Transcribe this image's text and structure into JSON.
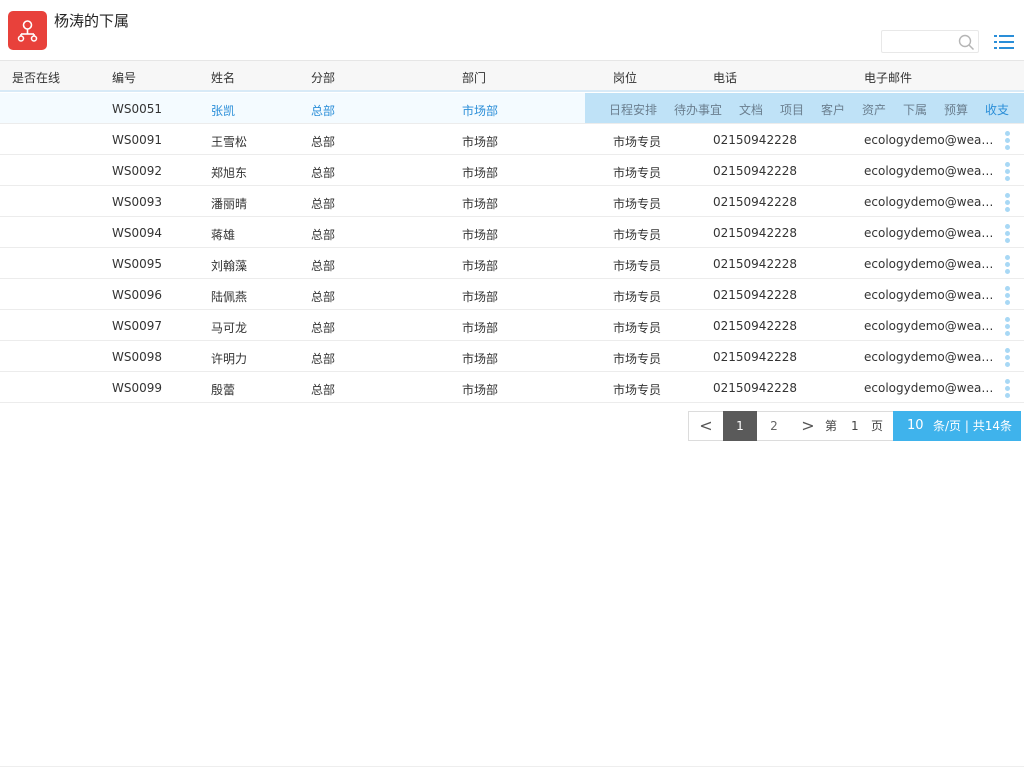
{
  "header": {
    "title": "杨涛的下属",
    "logo_icon": "org-tree-icon",
    "search": {
      "value": "",
      "placeholder": ""
    },
    "menu_icon": "list-menu-icon"
  },
  "table": {
    "columns": [
      "是否在线",
      "编号",
      "姓名",
      "分部",
      "部门",
      "岗位",
      "电话",
      "电子邮件"
    ],
    "rows": [
      {
        "online": "",
        "id": "WS0051",
        "name": "张凯",
        "branch": "总部",
        "dept": "市场部",
        "post": "",
        "phone": "",
        "email": ""
      },
      {
        "online": "",
        "id": "WS0091",
        "name": "王雪松",
        "branch": "总部",
        "dept": "市场部",
        "post": "市场专员",
        "phone": "02150942228",
        "email": "ecologydemo@weav..."
      },
      {
        "online": "",
        "id": "WS0092",
        "name": "郑旭东",
        "branch": "总部",
        "dept": "市场部",
        "post": "市场专员",
        "phone": "02150942228",
        "email": "ecologydemo@weav..."
      },
      {
        "online": "",
        "id": "WS0093",
        "name": "潘丽晴",
        "branch": "总部",
        "dept": "市场部",
        "post": "市场专员",
        "phone": "02150942228",
        "email": "ecologydemo@weav..."
      },
      {
        "online": "",
        "id": "WS0094",
        "name": "蒋雄",
        "branch": "总部",
        "dept": "市场部",
        "post": "市场专员",
        "phone": "02150942228",
        "email": "ecologydemo@weav..."
      },
      {
        "online": "",
        "id": "WS0095",
        "name": "刘翰藻",
        "branch": "总部",
        "dept": "市场部",
        "post": "市场专员",
        "phone": "02150942228",
        "email": "ecologydemo@weav..."
      },
      {
        "online": "",
        "id": "WS0096",
        "name": "陆佩燕",
        "branch": "总部",
        "dept": "市场部",
        "post": "市场专员",
        "phone": "02150942228",
        "email": "ecologydemo@weav..."
      },
      {
        "online": "",
        "id": "WS0097",
        "name": "马可龙",
        "branch": "总部",
        "dept": "市场部",
        "post": "市场专员",
        "phone": "02150942228",
        "email": "ecologydemo@weav..."
      },
      {
        "online": "",
        "id": "WS0098",
        "name": "许明力",
        "branch": "总部",
        "dept": "市场部",
        "post": "市场专员",
        "phone": "02150942228",
        "email": "ecologydemo@weav..."
      },
      {
        "online": "",
        "id": "WS0099",
        "name": "殷蕾",
        "branch": "总部",
        "dept": "市场部",
        "post": "市场专员",
        "phone": "02150942228",
        "email": "ecologydemo@weav..."
      }
    ],
    "row_actions": [
      "日程安排",
      "待办事宜",
      "文档",
      "项目",
      "客户",
      "资产",
      "下属",
      "预算",
      "收支"
    ]
  },
  "pagination": {
    "prev": "<",
    "next": ">",
    "pages": [
      "1",
      "2"
    ],
    "current": "1",
    "goto_prefix": "第",
    "goto_value": "1",
    "goto_suffix": "页",
    "page_size": "10",
    "page_size_text": "条/页 | 共14条"
  },
  "colors": {
    "logo": "#e8413b",
    "accent": "#2a8ed8",
    "action_bar": "#bfe2f7",
    "page_size_bg": "#3fb3ec",
    "active_page_bg": "#5a5a5a"
  }
}
